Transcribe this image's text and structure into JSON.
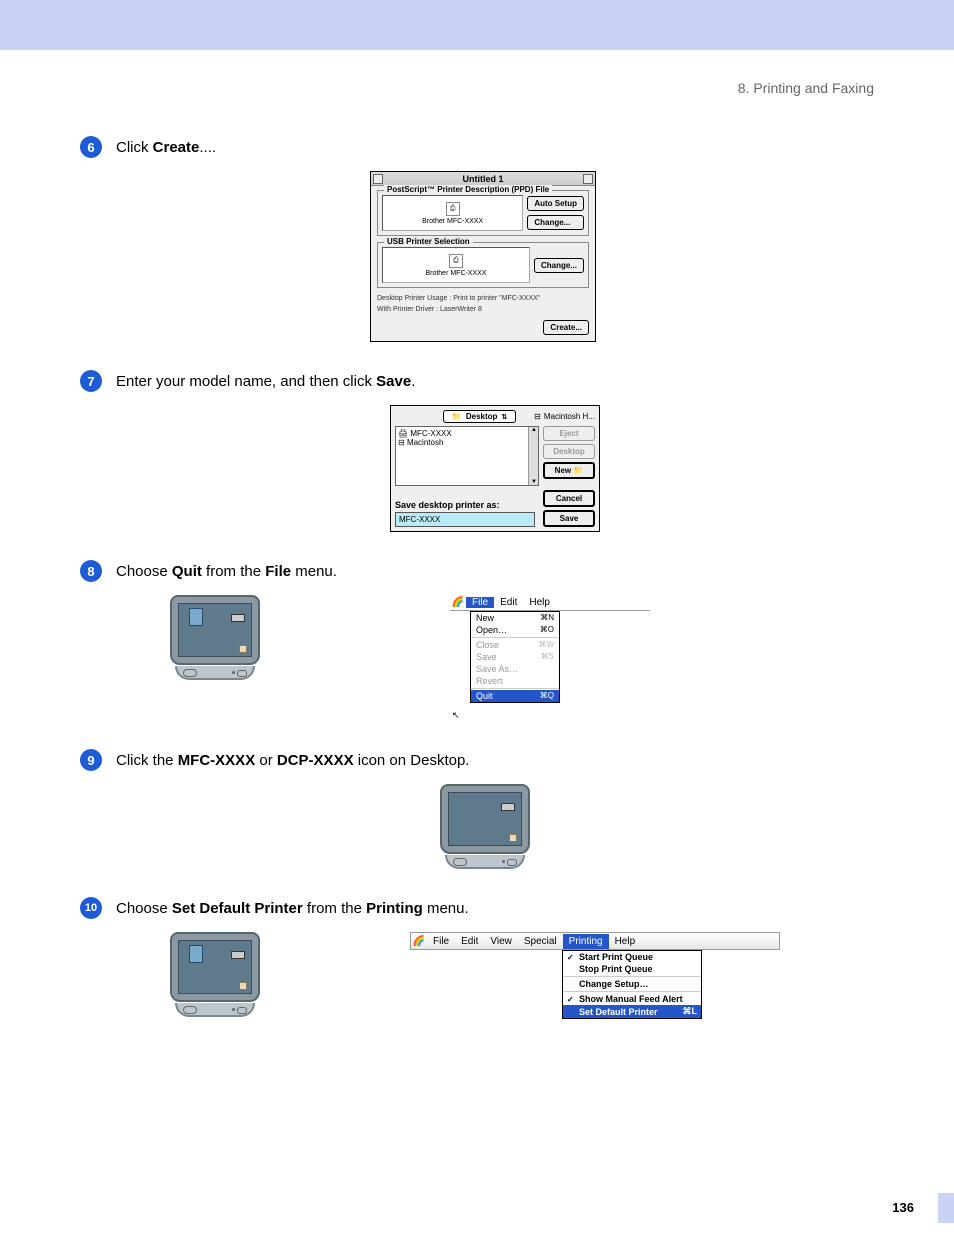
{
  "header": {
    "section": "8. Printing and Faxing"
  },
  "page_number": "136",
  "steps": {
    "s6": {
      "num": "6",
      "pre": "Click ",
      "b1": "Create",
      "post": "...."
    },
    "s7": {
      "num": "7",
      "pre": "Enter your model name, and then click ",
      "b1": "Save",
      "post": "."
    },
    "s8": {
      "num": "8",
      "pre": "Choose ",
      "b1": "Quit",
      "mid": " from the ",
      "b2": "File",
      "post": " menu."
    },
    "s9": {
      "num": "9",
      "pre": "Click the ",
      "b1": "MFC-XXXX",
      "mid": " or ",
      "b2": "DCP-XXXX",
      "post": " icon on Desktop."
    },
    "s10": {
      "num": "10",
      "pre": "Choose ",
      "b1": "Set Default Printer",
      "mid": " from the ",
      "b2": "Printing",
      "post": " menu."
    }
  },
  "dlg1": {
    "title": "Untitled 1",
    "fs1": {
      "legend": "PostScript™ Printer Description (PPD) File",
      "caption": "Brother MFC-XXXX",
      "btn_auto": "Auto Setup",
      "btn_change": "Change..."
    },
    "fs2": {
      "legend": "USB Printer Selection",
      "caption": "Brother MFC-XXXX",
      "btn_change": "Change..."
    },
    "line1": "Desktop Printer Usage : Print to printer \"MFC-XXXX\"",
    "line2": "With Printer Driver : LaserWriter 8",
    "btn_create": "Create..."
  },
  "dlg2": {
    "popup": "Desktop",
    "disk": "Macintosh H...",
    "list": {
      "item1": "MFC-XXXX",
      "item2": "Macintosh"
    },
    "btn_eject": "Eject",
    "btn_desktop": "Desktop",
    "btn_new": "New",
    "btn_cancel": "Cancel",
    "btn_save": "Save",
    "save_label": "Save desktop printer as:",
    "save_value": "MFC-XXXX"
  },
  "filemenu": {
    "bar": {
      "file": "File",
      "edit": "Edit",
      "help": "Help"
    },
    "items": {
      "new": {
        "label": "New",
        "sc": "⌘N"
      },
      "open": {
        "label": "Open…",
        "sc": "⌘O"
      },
      "close": {
        "label": "Close",
        "sc": "⌘W"
      },
      "save": {
        "label": "Save",
        "sc": "⌘S"
      },
      "saveas": {
        "label": "Save As…",
        "sc": ""
      },
      "revert": {
        "label": "Revert",
        "sc": ""
      },
      "quit": {
        "label": "Quit",
        "sc": "⌘Q"
      }
    }
  },
  "printmenu": {
    "bar": {
      "file": "File",
      "edit": "Edit",
      "view": "View",
      "special": "Special",
      "printing": "Printing",
      "help": "Help"
    },
    "items": {
      "start": "Start Print Queue",
      "stop": "Stop Print Queue",
      "change": "Change Setup…",
      "manual": "Show Manual Feed Alert",
      "setdef": "Set Default Printer",
      "setdef_sc": "⌘L"
    }
  }
}
